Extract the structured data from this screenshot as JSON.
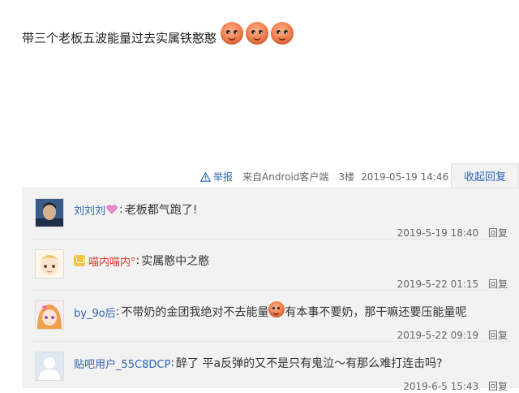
{
  "post": {
    "text": "带三个老板五波能量过去实属铁憨憨",
    "emoji_icons": [
      "orange-face-emoji",
      "orange-face-emoji",
      "orange-face-emoji"
    ]
  },
  "meta": {
    "report_label": "举报",
    "source": "来自Android客户端",
    "floor": "3楼",
    "time": "2019-05-19 14:46",
    "collapse_label": "收起回复"
  },
  "replies": [
    {
      "user": "刘刘刘",
      "badge": "pink-heart-icon",
      "text": "老板都气跑了!",
      "time": "2019-5-19 18:40",
      "reply_label": "回复"
    },
    {
      "user": "喵内喵内°",
      "badge": "vip-member-icon",
      "text": "实属憨中之憨",
      "time": "2019-5-22 01:15",
      "reply_label": "回复"
    },
    {
      "user": "by_9o后",
      "text_before": "不带奶的金团我绝对不去能量",
      "text_after": "有本事不要奶，那干嘛还要压能量呢",
      "time": "2019-5-22 09:19",
      "reply_label": "回复"
    },
    {
      "user": "贴吧用户_55C8DCP",
      "text": "醉了 平a反弹的又不是只有鬼泣～有那么难打连击吗?",
      "time": "2019-6-5 15:43",
      "reply_label": "回复"
    }
  ],
  "colors": {
    "link_blue": "#2d64b3",
    "username_red": "#e0372a",
    "reply_bg": "#f2f2f2"
  }
}
